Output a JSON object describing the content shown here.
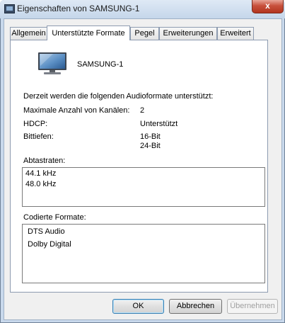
{
  "window": {
    "title": "Eigenschaften von SAMSUNG-1",
    "close_glyph": "x"
  },
  "tabs": [
    {
      "label": "Allgemein"
    },
    {
      "label": "Unterstützte Formate"
    },
    {
      "label": "Pegel"
    },
    {
      "label": "Erweiterungen"
    },
    {
      "label": "Erweitert"
    }
  ],
  "device": {
    "name": "SAMSUNG-1",
    "icon": "monitor-icon"
  },
  "heading": "Derzeit werden die folgenden Audioformate unterstützt:",
  "rows": {
    "channels_label": "Maximale Anzahl von Kanälen:",
    "channels_value": "2",
    "hdcp_label": "HDCP:",
    "hdcp_value": "Unterstützt",
    "bitdepth_label": "Bittiefen:",
    "bitdepth_values": [
      "16-Bit",
      "24-Bit"
    ]
  },
  "sample_rates": {
    "label": "Abtastraten:",
    "items": [
      "44.1 kHz",
      "48.0 kHz"
    ]
  },
  "encoded_formats": {
    "label": "Codierte Formate:",
    "items": [
      "DTS Audio",
      "Dolby Digital"
    ]
  },
  "buttons": {
    "ok": "OK",
    "cancel": "Abbrechen",
    "apply": "Übernehmen"
  }
}
